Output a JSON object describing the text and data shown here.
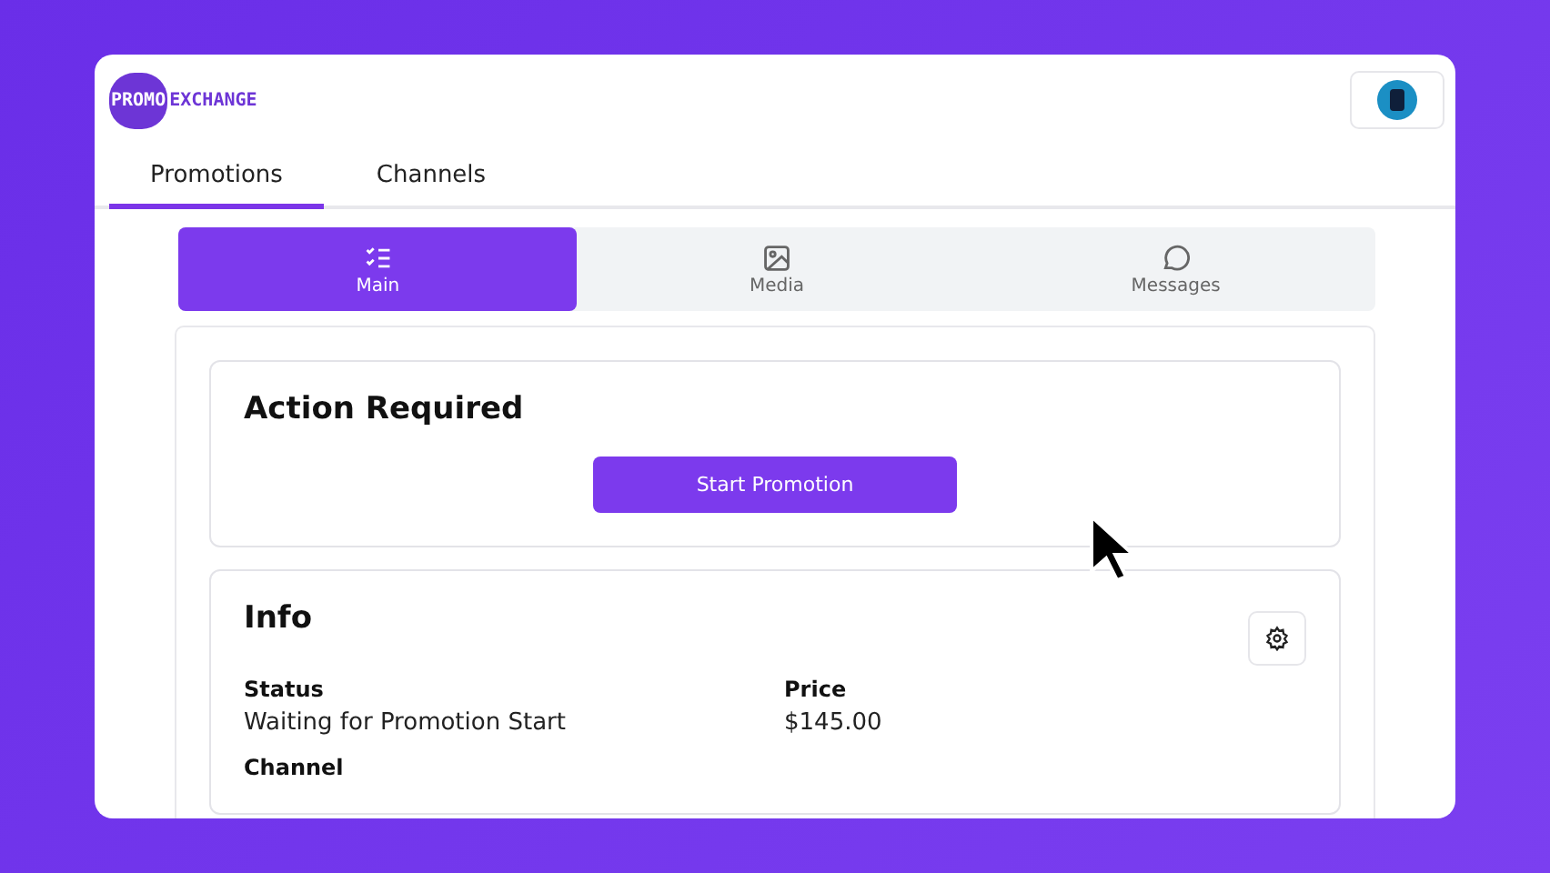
{
  "logo": {
    "left": "PROMO",
    "right": "EXCHANGE"
  },
  "nav_tabs": [
    {
      "label": "Promotions",
      "selected": true
    },
    {
      "label": "Channels",
      "selected": false
    }
  ],
  "sub_tabs": [
    {
      "label": "Main",
      "kind": "checklist",
      "selected": true
    },
    {
      "label": "Media",
      "kind": "image",
      "selected": false
    },
    {
      "label": "Messages",
      "kind": "chat",
      "selected": false
    }
  ],
  "action_card": {
    "title": "Action Required",
    "button": "Start Promotion"
  },
  "info_card": {
    "title": "Info",
    "fields": [
      {
        "label": "Status",
        "value": "Waiting for Promotion Start"
      },
      {
        "label": "Price",
        "value": "$145.00"
      },
      {
        "label": "Channel"
      }
    ]
  }
}
